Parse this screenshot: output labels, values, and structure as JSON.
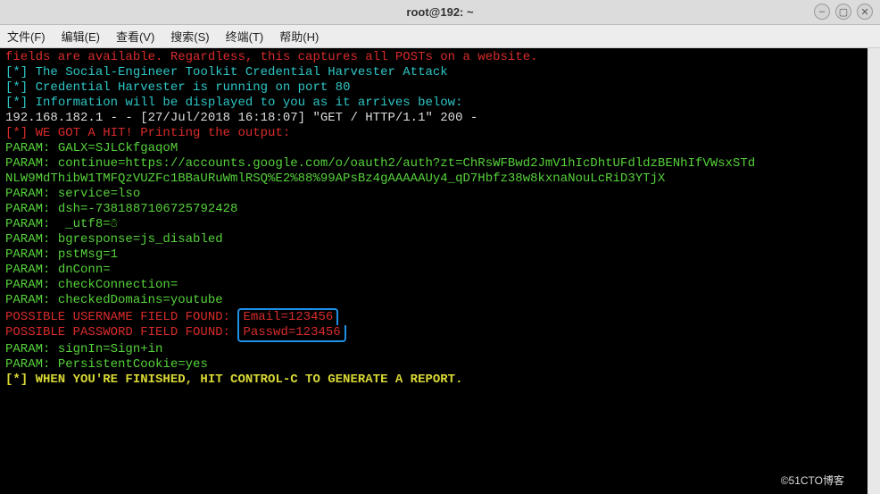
{
  "window": {
    "title": "root@192: ~",
    "controls": {
      "minimize": "–",
      "maximize": "▢",
      "close": "✕"
    }
  },
  "menu": {
    "file": "文件(F)",
    "edit": "编辑(E)",
    "view": "查看(V)",
    "search": "搜索(S)",
    "terminal": "终端(T)",
    "help": "帮助(H)"
  },
  "lines": {
    "l1": "fields are available. Regardless, this captures all POSTs on a website.",
    "l2a": "[*] ",
    "l2b": "The Social-Engineer Toolkit Credential Harvester Attack",
    "l3a": "[*] ",
    "l3b": "Credential Harvester is running on port 80",
    "l4a": "[*] ",
    "l4b": "Information will be displayed to you as it arrives below:",
    "l5": "192.168.182.1 - - [27/Jul/2018 16:18:07] \"GET / HTTP/1.1\" 200 -",
    "l6": "[*] WE GOT A HIT! Printing the output:",
    "p1a": "PARAM: ",
    "p1b": "GALX=SJLCkfgaqoM",
    "p2a": "PARAM: ",
    "p2b": "continue=https://accounts.google.com/o/oauth2/auth?zt=ChRsWFBwd2JmV1hIcDhtUFdldzBENhIfVWsxSTd",
    "p2c": "NLW9MdThibW1TMFQzVUZFc1BBaURuWmlRSQ%E2%88%99APsBz4gAAAAAUy4_qD7Hbfz38w8kxnaNouLcRiD3YTjX",
    "p3a": "PARAM: ",
    "p3b": "service=lso",
    "p4a": "PARAM: ",
    "p4b": "dsh=-7381887106725792428",
    "p5a": "PARAM: ",
    "p5b": " _utf8=☃",
    "p6a": "PARAM: ",
    "p6b": "bgresponse=js_disabled",
    "p7a": "PARAM: ",
    "p7b": "pstMsg=1",
    "p8a": "PARAM: ",
    "p8b": "dnConn=",
    "p9a": "PARAM: ",
    "p9b": "checkConnection=",
    "p10a": "PARAM: ",
    "p10b": "checkedDomains=youtube",
    "u1a": "POSSIBLE USERNAME FIELD FOUND: ",
    "u1b": "Email=123456",
    "u2a": "POSSIBLE PASSWORD FIELD FOUND: ",
    "u2b": "Passwd=123456",
    "p11a": "PARAM: ",
    "p11b": "signIn=Sign+in",
    "p12a": "PARAM: ",
    "p12b": "PersistentCookie=yes",
    "fin": "[*] WHEN YOU'RE FINISHED, HIT CONTROL-C TO GENERATE A REPORT."
  },
  "watermark": "©51CTO博客"
}
